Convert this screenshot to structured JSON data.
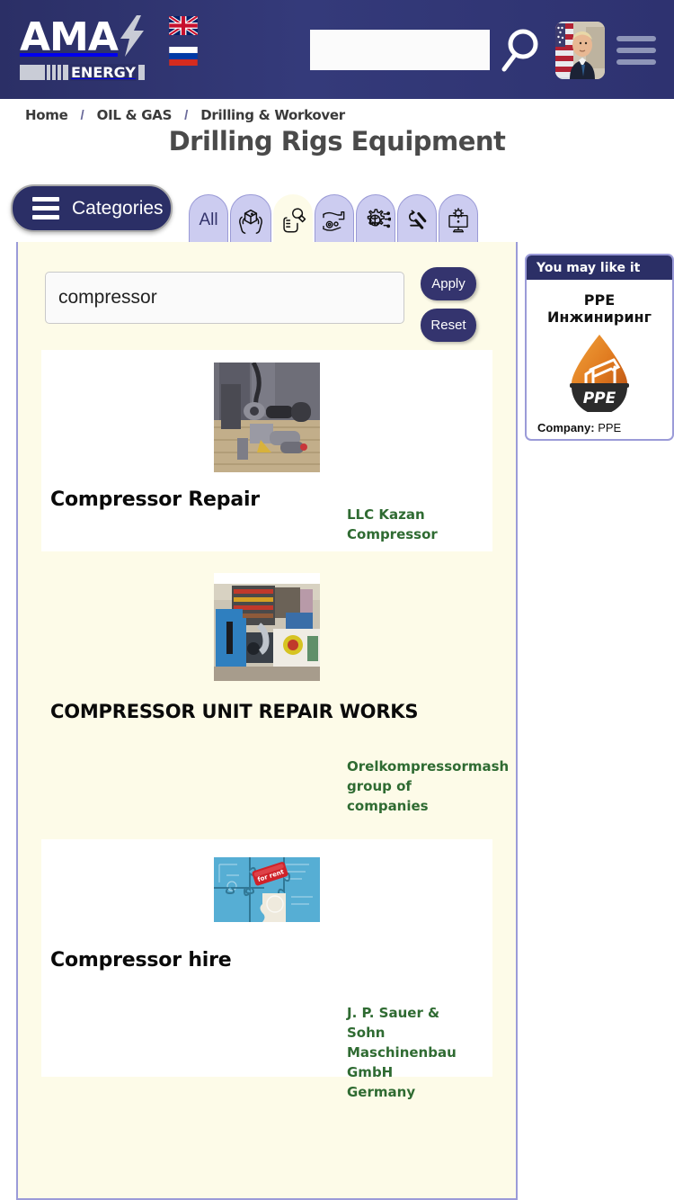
{
  "header": {
    "logo_main": "AMA",
    "logo_sub": "ENERGY",
    "logo_bolt_icon": "lightning-bolt-icon",
    "search_value": "",
    "search_placeholder": "",
    "search_icon": "magnifier-icon",
    "menu_icon": "hamburger-menu-icon",
    "avatar_icon": "user-avatar-photo",
    "languages": [
      {
        "code": "en",
        "name": "United Kingdom flag"
      },
      {
        "code": "ru",
        "name": "Russia flag"
      }
    ]
  },
  "breadcrumb": {
    "separator": "/",
    "items": [
      {
        "label": "Home"
      },
      {
        "label": "OIL & GAS"
      },
      {
        "label": "Drilling & Workover"
      }
    ]
  },
  "page_title": "Drilling Rigs Equipment",
  "categories_button": {
    "label": "Categories",
    "icon": "hamburger-menu-icon"
  },
  "tabs": [
    {
      "label": "All",
      "icon": "all-text",
      "active": false
    },
    {
      "label": "",
      "icon": "hands-holding-box-icon",
      "active": false
    },
    {
      "label": "",
      "icon": "hand-wrench-icon",
      "active": true
    },
    {
      "label": "",
      "icon": "hand-gear-service-icon",
      "active": false
    },
    {
      "label": "",
      "icon": "gear-globe-network-icon",
      "active": false
    },
    {
      "label": "",
      "icon": "drill-tools-icon",
      "active": false
    },
    {
      "label": "",
      "icon": "monitor-gear-icon",
      "active": false
    }
  ],
  "filters": {
    "search_value": "compressor",
    "search_placeholder": "",
    "apply_label": "Apply",
    "reset_label": "Reset"
  },
  "results": [
    {
      "title": "Compressor Repair",
      "company": "LLC Kazan Compressor",
      "country": "",
      "thumb": "compressor-repair-photo",
      "card_style": "white"
    },
    {
      "title": "COMPRESSOR UNIT REPAIR WORKS",
      "company": "Orelkompressormash group of companies",
      "country": "",
      "thumb": "compressor-unit-workshop-photo",
      "card_style": "plain"
    },
    {
      "title": "Compressor hire",
      "company": "J. P. Sauer & Sohn Maschinenbau GmbH",
      "country": "Germany",
      "thumb": "puzzle-for-rent-photo",
      "card_style": "white"
    }
  ],
  "sidebar": {
    "header": "You may like it",
    "item_title": "PPE Инжиниринг",
    "logo_icon": "ppe-oil-droplet-pumpjack-logo",
    "logo_text": "PPE",
    "company_label": "Company:",
    "company_value": "PPE"
  },
  "colors": {
    "brand_navy": "#2b2f66",
    "panel_cream": "#fdfbe8",
    "panel_border": "#9b9bd8",
    "tab_lilac": "#ccccf0",
    "company_green": "#2f6b32"
  }
}
